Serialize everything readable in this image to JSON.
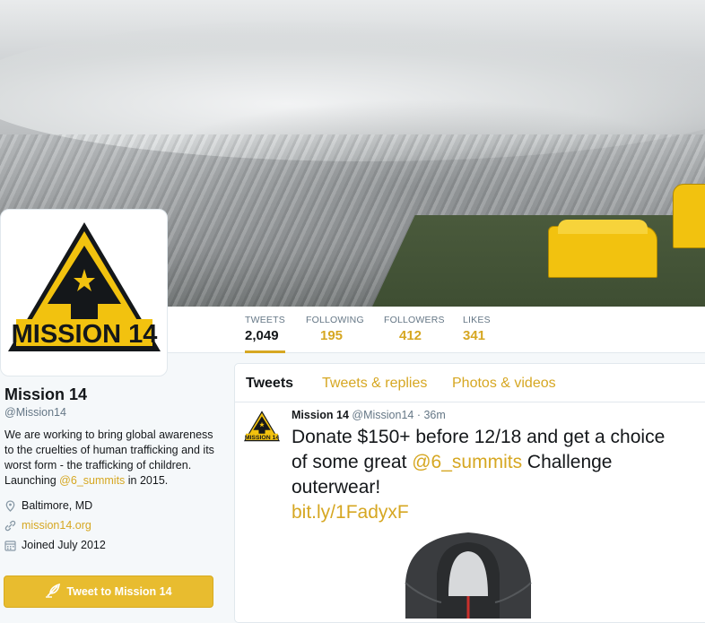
{
  "profile": {
    "name": "Mission 14",
    "handle": "@Mission14",
    "bio_text": "We are working to bring global awareness to the cruelties of human trafficking and its worst form - the trafficking of children. Launching ",
    "bio_mention": "@6_summits",
    "bio_tail": " in 2015.",
    "location": "Baltimore, MD",
    "website": "mission14.org",
    "joined": "Joined July 2012",
    "tweet_to_label": "Tweet to Mission 14",
    "logo_text": "MISSION 14"
  },
  "stats": [
    {
      "label": "TWEETS",
      "value": "2,049"
    },
    {
      "label": "FOLLOWING",
      "value": "195"
    },
    {
      "label": "FOLLOWERS",
      "value": "412"
    },
    {
      "label": "LIKES",
      "value": "341"
    }
  ],
  "tabs": [
    {
      "label": "Tweets"
    },
    {
      "label": "Tweets & replies"
    },
    {
      "label": "Photos & videos"
    }
  ],
  "tweet": {
    "name": "Mission 14",
    "handle": "@Mission14",
    "sep": " · ",
    "time": "36m",
    "text_a": "Donate $150+ before 12/18 and get a choice of some great ",
    "mention": "@6_summits",
    "text_b": " Challenge outerwear!",
    "url": "bit.ly/1FadyxF"
  },
  "colors": {
    "accent": "#d6a722",
    "button": "#e8bc2f",
    "logo_yellow": "#f2c20f"
  },
  "icons": [
    "location-icon",
    "link-icon",
    "calendar-icon",
    "feather-icon"
  ]
}
